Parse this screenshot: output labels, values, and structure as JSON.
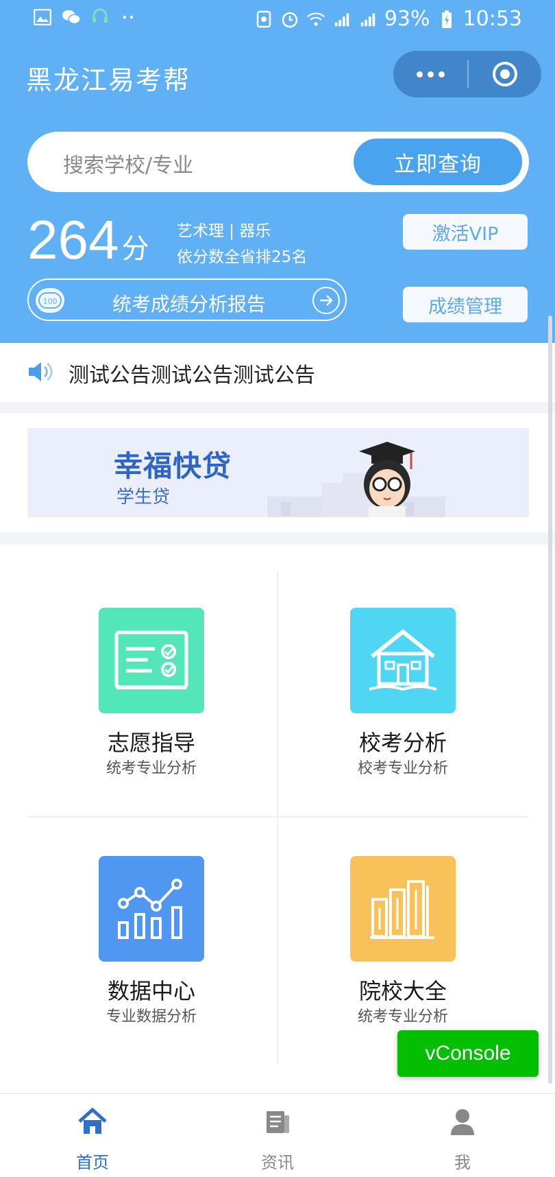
{
  "status_bar": {
    "battery": "93%",
    "time": "10:53"
  },
  "header": {
    "title": "黑龙江易考帮",
    "search": {
      "placeholder": "搜索学校/专业",
      "button": "立即查询"
    },
    "score": {
      "value": "264",
      "unit": "分",
      "category": "艺术理 | 器乐",
      "rank": "依分数全省排25名",
      "report_label": "统考成绩分析报告",
      "report_badge": "100"
    },
    "vip_button": "激活VIP",
    "manage_button": "成绩管理"
  },
  "notice": {
    "text": "测试公告测试公告测试公告"
  },
  "banner": {
    "title": "幸福快贷",
    "subtitle": "学生贷"
  },
  "features": [
    {
      "name": "志愿指导",
      "desc": "统考专业分析",
      "color": "#52e6b8",
      "icon": "checklist-icon"
    },
    {
      "name": "校考分析",
      "desc": "校考专业分析",
      "color": "#4fd6f2",
      "icon": "school-house-icon"
    },
    {
      "name": "数据中心",
      "desc": "专业数据分析",
      "color": "#4f97f0",
      "icon": "line-chart-icon"
    },
    {
      "name": "院校大全",
      "desc": "统考专业分析",
      "color": "#f9c15a",
      "icon": "books-icon"
    }
  ],
  "vconsole": "vConsole",
  "tabbar": {
    "items": [
      {
        "label": "首页",
        "icon": "home-icon",
        "active": true
      },
      {
        "label": "资讯",
        "icon": "news-icon",
        "active": false
      },
      {
        "label": "我",
        "icon": "user-icon",
        "active": false
      }
    ]
  },
  "colors": {
    "header_bg": "#5fb0f4",
    "accent": "#4aa3ef",
    "active_tab": "#2f6fd0",
    "vconsole": "#04be02"
  }
}
